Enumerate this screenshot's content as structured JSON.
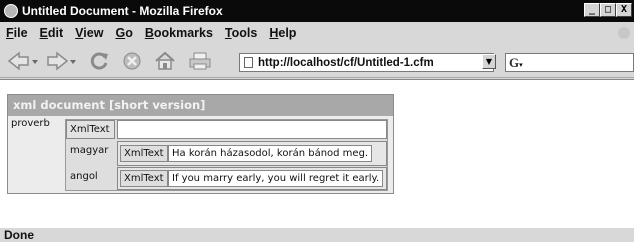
{
  "window": {
    "title": "Untitled Document - Mozilla Firefox",
    "minimize": "_",
    "maximize": "□",
    "close": "X"
  },
  "menu": {
    "items": [
      {
        "underline": "F",
        "rest": "ile"
      },
      {
        "underline": "E",
        "rest": "dit"
      },
      {
        "underline": "V",
        "rest": "iew"
      },
      {
        "underline": "G",
        "rest": "o"
      },
      {
        "underline": "B",
        "rest": "ookmarks"
      },
      {
        "underline": "T",
        "rest": "ools"
      },
      {
        "underline": "H",
        "rest": "elp"
      }
    ]
  },
  "toolbar": {
    "url": "http://localhost/cf/Untitled-1.cfm",
    "search_engine_glyph": "G"
  },
  "xml": {
    "header": "xml document [short version]",
    "root_label": "proverb",
    "text_tag": "XmlText",
    "rows": [
      {
        "label": "magyar",
        "tag": "XmlText",
        "value": "Ha korán házasodol, korán bánod meg."
      },
      {
        "label": "angol",
        "tag": "XmlText",
        "value": "If you marry early, you will regret it early."
      }
    ]
  },
  "status": {
    "text": "Done"
  },
  "colors": {
    "titlebar": "#0a0a0a",
    "chrome": "#d8d8d8",
    "xml_header": "#a8a8a8",
    "content": "#ffffff"
  }
}
